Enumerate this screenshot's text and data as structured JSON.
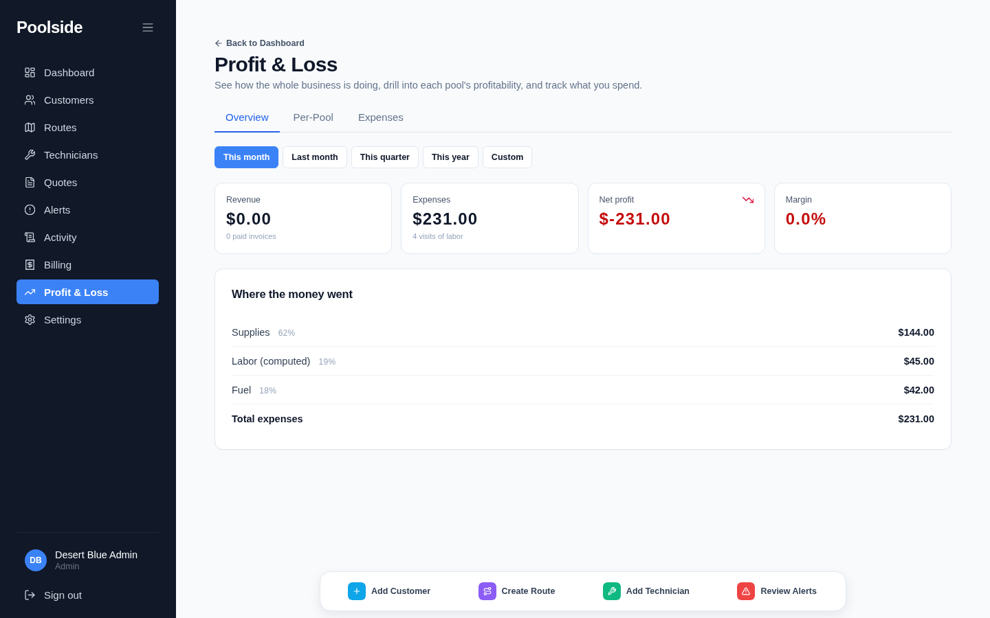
{
  "sidebar": {
    "brand": "Poolside",
    "nav": [
      {
        "label": "Dashboard",
        "selected": false
      },
      {
        "label": "Customers",
        "selected": false
      },
      {
        "label": "Routes",
        "selected": false
      },
      {
        "label": "Technicians",
        "selected": false
      },
      {
        "label": "Quotes",
        "selected": false
      },
      {
        "label": "Alerts",
        "selected": false
      },
      {
        "label": "Activity",
        "selected": false
      },
      {
        "label": "Billing",
        "selected": false
      },
      {
        "label": "Profit & Loss",
        "selected": true
      },
      {
        "label": "Settings",
        "selected": false
      }
    ],
    "user": {
      "initials": "DB",
      "name": "Desert Blue Admin",
      "role": "Admin"
    },
    "sign_out": "Sign out"
  },
  "header": {
    "back_link": "Back to Dashboard",
    "title": "Profit & Loss",
    "subtitle": "See how the whole business is doing, drill into each pool's profitability, and track what you spend."
  },
  "tabs": [
    {
      "label": "Overview",
      "selected": true
    },
    {
      "label": "Per-Pool",
      "selected": false
    },
    {
      "label": "Expenses",
      "selected": false
    }
  ],
  "periods": [
    {
      "label": "This month",
      "selected": true
    },
    {
      "label": "Last month",
      "selected": false
    },
    {
      "label": "This quarter",
      "selected": false
    },
    {
      "label": "This year",
      "selected": false
    },
    {
      "label": "Custom",
      "selected": false
    }
  ],
  "metrics": [
    {
      "label": "Revenue",
      "value": "$0.00",
      "note": "0 paid invoices",
      "negative": false,
      "falling": false
    },
    {
      "label": "Expenses",
      "value": "$231.00",
      "note": "4 visits of labor",
      "negative": false,
      "falling": false
    },
    {
      "label": "Net profit",
      "value": "$-231.00",
      "negative": true,
      "falling": true
    },
    {
      "label": "Margin",
      "value": "0.0%",
      "negative": true,
      "falling": false
    }
  ],
  "breakdown": {
    "title": "Where the money went",
    "rows": [
      {
        "kind": "item",
        "label": "Supplies",
        "share": "62%",
        "amount": "$144.00"
      },
      {
        "kind": "item",
        "label": "Labor (computed)",
        "share": "19%",
        "amount": "$45.00"
      },
      {
        "kind": "item",
        "label": "Fuel",
        "share": "18%",
        "amount": "$42.00"
      },
      {
        "kind": "total",
        "label": "Total expenses",
        "amount": "$231.00"
      }
    ]
  },
  "quick_actions": [
    {
      "label": "Add Customer",
      "color": "#0ea5e9"
    },
    {
      "label": "Create Route",
      "color": "#8b5cf6"
    },
    {
      "label": "Add Technician",
      "color": "#10b981"
    },
    {
      "label": "Review Alerts",
      "color": "#ef4444"
    }
  ]
}
